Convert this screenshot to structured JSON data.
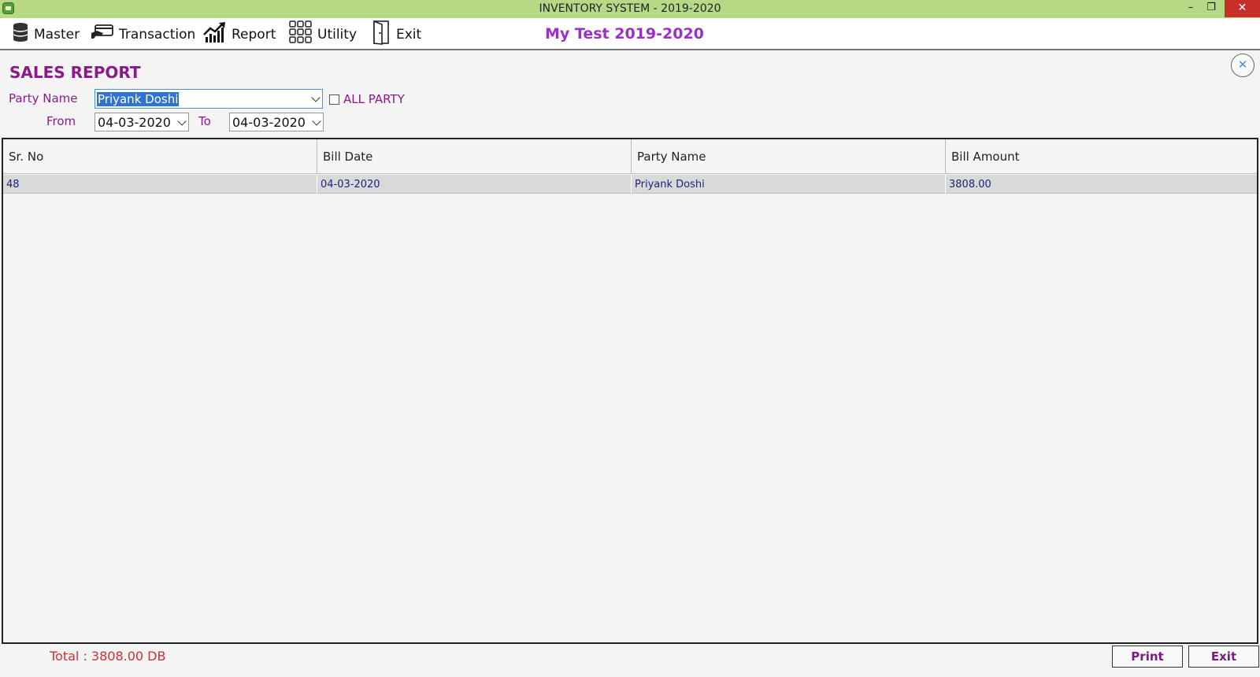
{
  "window": {
    "title": "INVENTORY SYSTEM - 2019-2020",
    "minimize": "–",
    "restore": "❐",
    "close": "✕"
  },
  "menu": {
    "items": [
      {
        "label": "Master",
        "icon": "database-icon"
      },
      {
        "label": "Transaction",
        "icon": "payment-card-icon"
      },
      {
        "label": "Report",
        "icon": "chart-growth-icon"
      },
      {
        "label": "Utility",
        "icon": "grid-apps-icon"
      },
      {
        "label": "Exit",
        "icon": "door-exit-icon"
      }
    ],
    "company": "My Test 2019-2020"
  },
  "report": {
    "title": "SALES REPORT",
    "close": "✕",
    "party_label": "Party Name",
    "party_value": "Priyank Doshi",
    "all_party_label": "ALL PARTY",
    "all_party_checked": false,
    "from_label": "From",
    "from_value": "04-03-2020",
    "to_label": "To",
    "to_value": "04-03-2020"
  },
  "table": {
    "columns": [
      "Sr. No",
      "Bill Date",
      "Party Name",
      "Bill Amount"
    ],
    "rows": [
      [
        "48",
        "04-03-2020",
        "Priyank Doshi",
        "3808.00"
      ]
    ]
  },
  "footer": {
    "total": "Total : 3808.00 DB",
    "print_label": "Print",
    "exit_label": "Exit"
  },
  "colors": {
    "titlebar": "#b5d984",
    "accent_purple": "#8b1a88",
    "company_purple": "#9b30c8",
    "total_red": "#d32f2f",
    "row_text": "#1a237e"
  }
}
